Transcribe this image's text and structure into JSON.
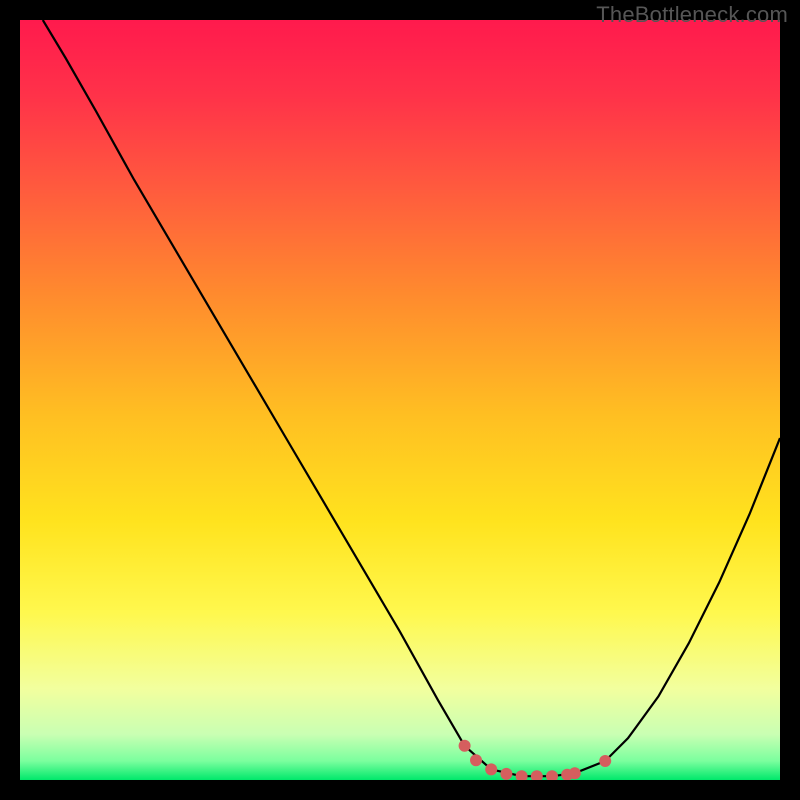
{
  "watermark": "TheBottleneck.com",
  "colors": {
    "accent_marker": "#d55e5e",
    "curve": "#000000",
    "frame": "#000000"
  },
  "gradient_stops": [
    {
      "offset": 0.0,
      "color": "#ff1a4d"
    },
    {
      "offset": 0.1,
      "color": "#ff3249"
    },
    {
      "offset": 0.22,
      "color": "#ff5a3e"
    },
    {
      "offset": 0.36,
      "color": "#ff8a2e"
    },
    {
      "offset": 0.52,
      "color": "#ffbf22"
    },
    {
      "offset": 0.66,
      "color": "#ffe31e"
    },
    {
      "offset": 0.78,
      "color": "#fff84e"
    },
    {
      "offset": 0.88,
      "color": "#f2ff9e"
    },
    {
      "offset": 0.94,
      "color": "#c9ffb3"
    },
    {
      "offset": 0.975,
      "color": "#7bff9e"
    },
    {
      "offset": 1.0,
      "color": "#00e86b"
    }
  ],
  "chart_data": {
    "type": "line",
    "title": "",
    "xlabel": "",
    "ylabel": "",
    "xlim": [
      0,
      100
    ],
    "ylim": [
      0,
      100
    ],
    "grid": false,
    "legend": false,
    "series": [
      {
        "name": "curve",
        "x": [
          3,
          6,
          10,
          15,
          20,
          25,
          30,
          35,
          40,
          45,
          50,
          55,
          58.5,
          62,
          66,
          70,
          73,
          77,
          80,
          84,
          88,
          92,
          96,
          100
        ],
        "y": [
          100,
          95,
          88,
          79,
          70.5,
          62,
          53.5,
          45,
          36.5,
          28,
          19.5,
          10.5,
          4.5,
          1.4,
          0.5,
          0.5,
          0.9,
          2.5,
          5.5,
          11,
          18,
          26,
          35,
          45
        ]
      }
    ],
    "markers": {
      "series": "curve",
      "x": [
        58.5,
        60,
        62,
        64,
        66,
        68,
        70,
        72,
        73,
        77
      ],
      "y": [
        4.5,
        2.6,
        1.4,
        0.8,
        0.5,
        0.5,
        0.5,
        0.7,
        0.9,
        2.5
      ],
      "radius_px": 6
    }
  }
}
